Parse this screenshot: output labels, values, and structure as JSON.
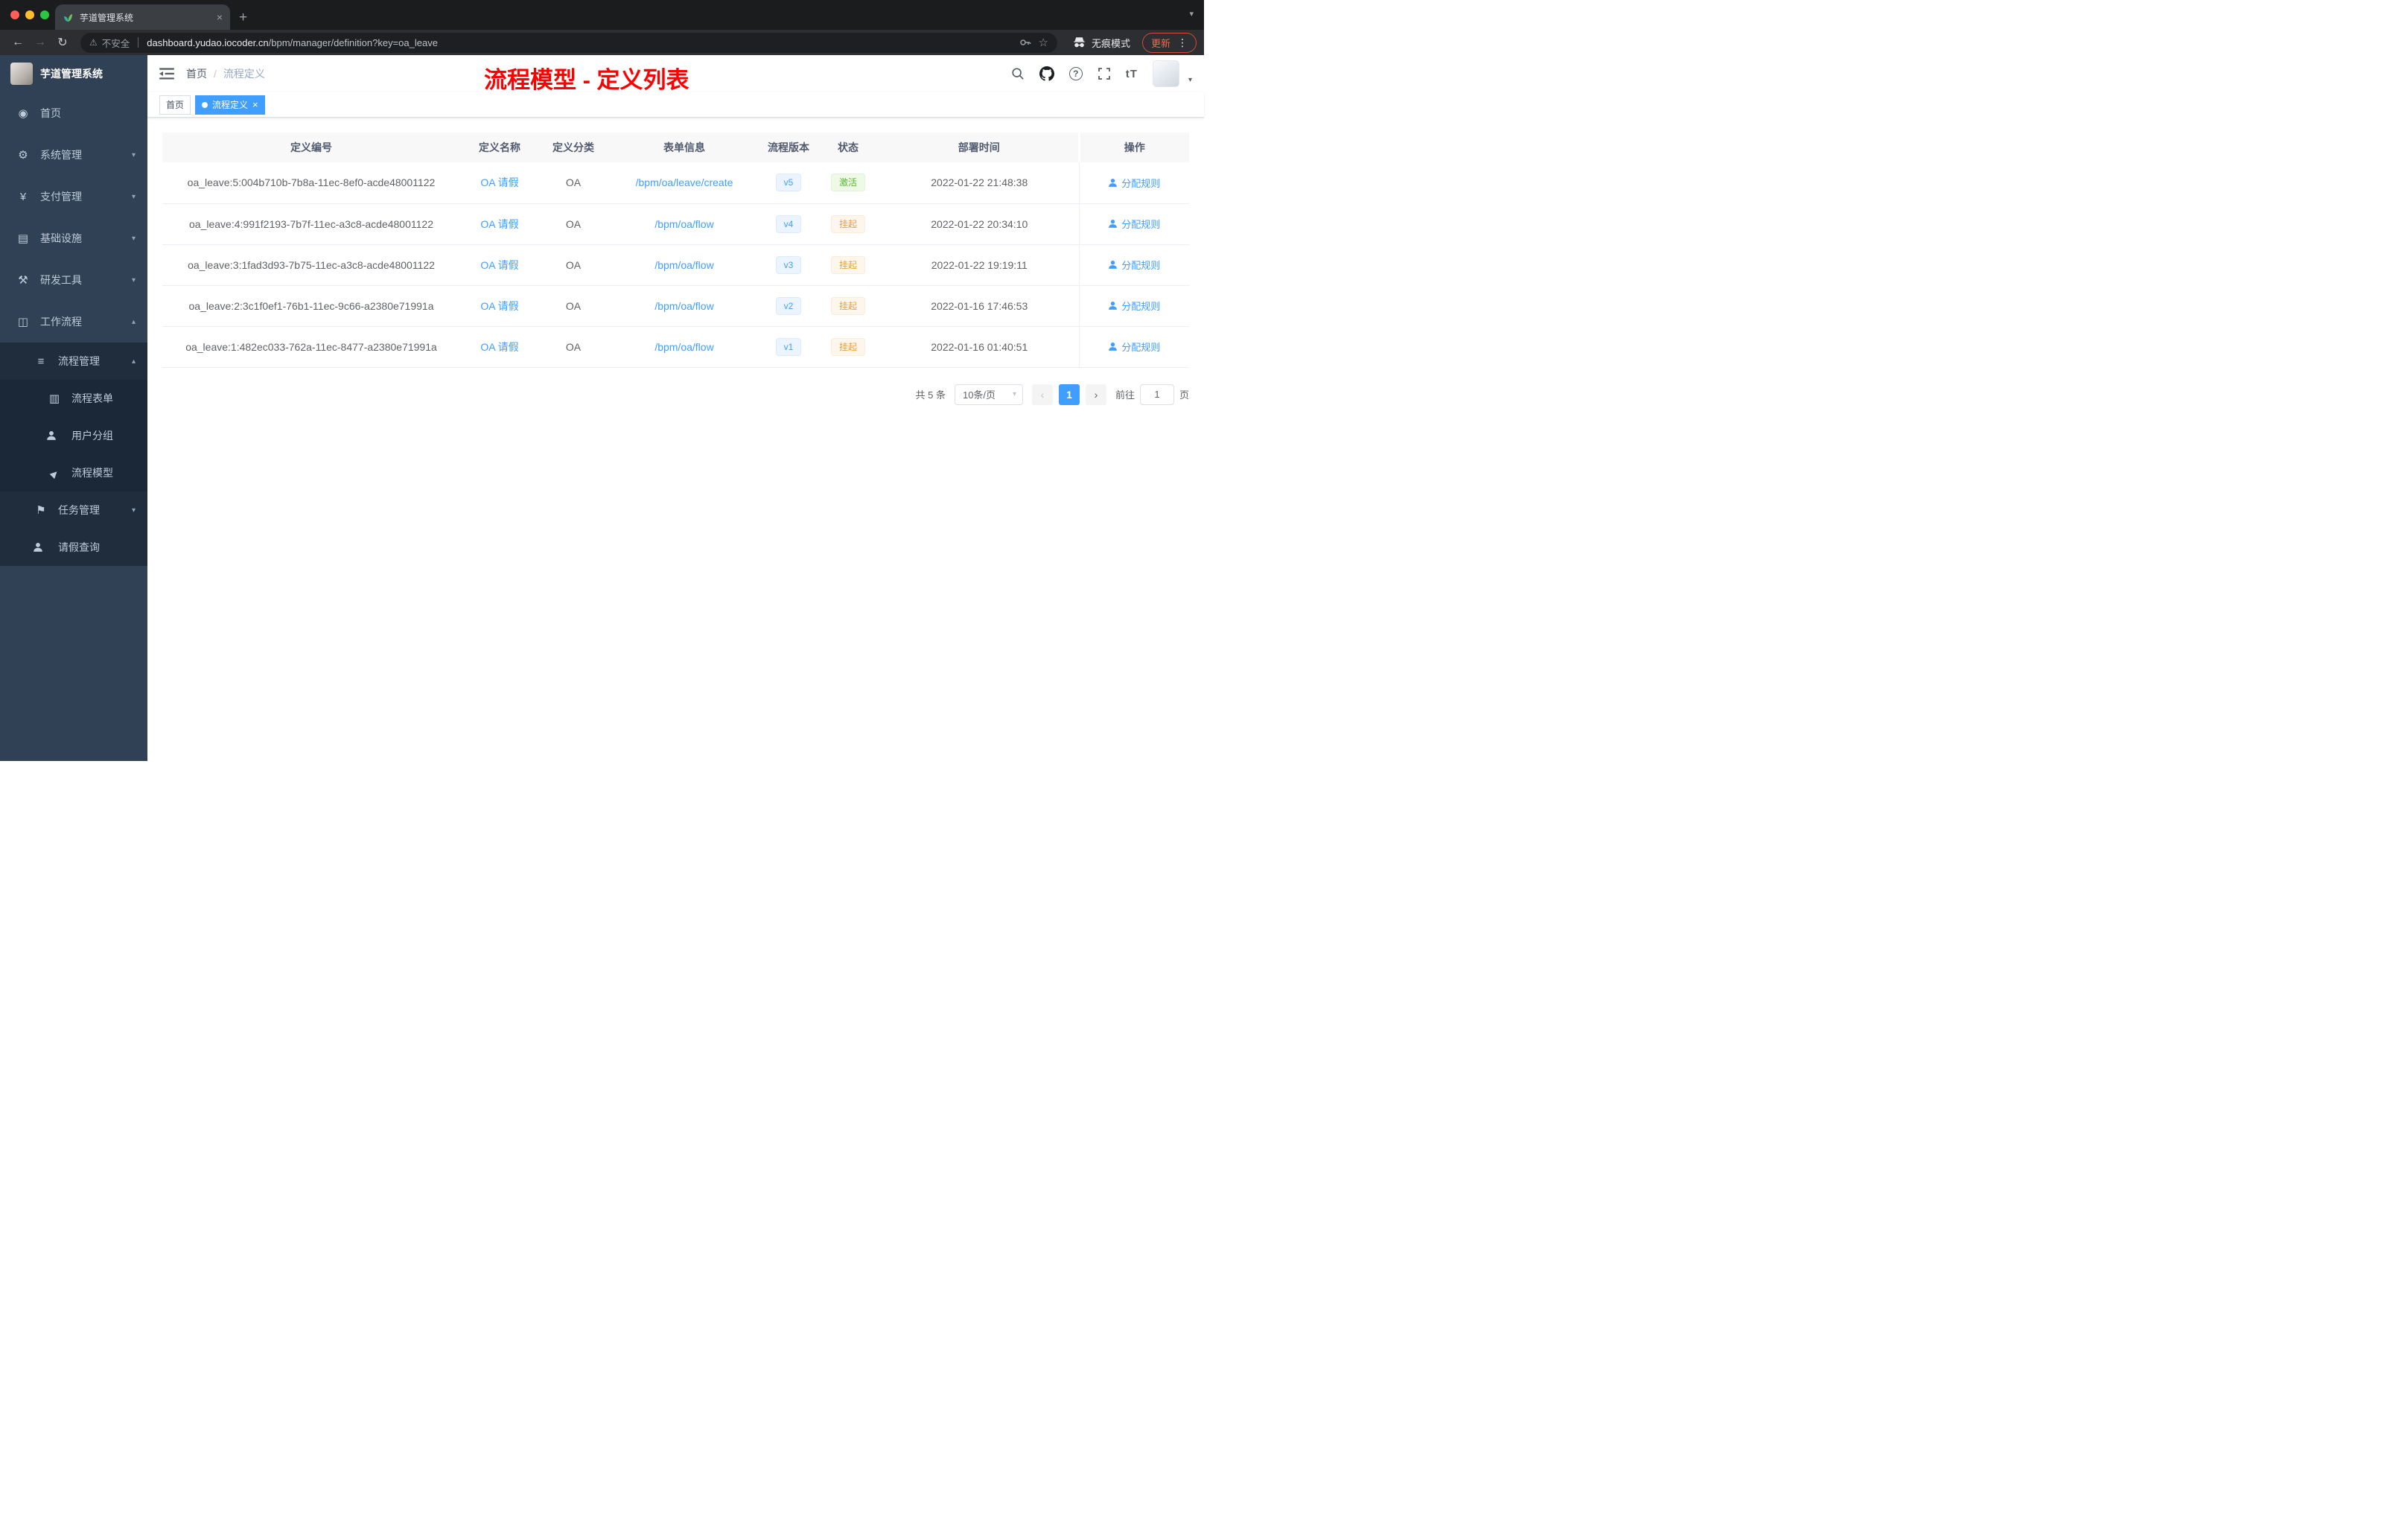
{
  "colors": {
    "accent": "#409eff",
    "success": "#67c23a",
    "warning": "#e6a23c",
    "annotation_red": "#ff0000",
    "sidebar_bg": "#304156",
    "submenu_bg": "#1f2d3d"
  },
  "browser": {
    "tab_title": "芋道管理系统",
    "new_tab_label": "+",
    "security_label": "不安全",
    "url_domain": "dashboard.yudao.iocoder.cn",
    "url_path": "/bpm/manager/definition?key=oa_leave",
    "incognito_label": "无痕模式",
    "update_label": "更新"
  },
  "sidebar": {
    "app_title": "芋道管理系统",
    "home": "首页",
    "system": "系统管理",
    "payment": "支付管理",
    "infrastructure": "基础设施",
    "devtools": "研发工具",
    "workflow": "工作流程",
    "process_mgmt": "流程管理",
    "process_form": "流程表单",
    "user_group": "用户分组",
    "process_model": "流程模型",
    "task_mgmt": "任务管理",
    "leave_query": "请假查询"
  },
  "header": {
    "breadcrumb_home": "首页",
    "breadcrumb_sep": "/",
    "breadcrumb_current": "流程定义",
    "annotation": "流程模型 - 定义列表"
  },
  "tags": {
    "home": "首页",
    "active": "流程定义",
    "close": "×"
  },
  "table": {
    "columns": [
      "定义编号",
      "定义名称",
      "定义分类",
      "表单信息",
      "流程版本",
      "状态",
      "部署时间",
      "操作"
    ],
    "rows": [
      {
        "id": "oa_leave:5:004b710b-7b8a-11ec-8ef0-acde48001122",
        "name": "OA 请假",
        "category": "OA",
        "form": "/bpm/oa/leave/create",
        "version": "v5",
        "status": {
          "label": "激活",
          "type": "success"
        },
        "deploy_time": "2022-01-22 21:48:38",
        "action": "分配规则"
      },
      {
        "id": "oa_leave:4:991f2193-7b7f-11ec-a3c8-acde48001122",
        "name": "OA 请假",
        "category": "OA",
        "form": "/bpm/oa/flow",
        "version": "v4",
        "status": {
          "label": "挂起",
          "type": "warning"
        },
        "deploy_time": "2022-01-22 20:34:10",
        "action": "分配规则"
      },
      {
        "id": "oa_leave:3:1fad3d93-7b75-11ec-a3c8-acde48001122",
        "name": "OA 请假",
        "category": "OA",
        "form": "/bpm/oa/flow",
        "version": "v3",
        "status": {
          "label": "挂起",
          "type": "warning"
        },
        "deploy_time": "2022-01-22 19:19:11",
        "action": "分配规则"
      },
      {
        "id": "oa_leave:2:3c1f0ef1-76b1-11ec-9c66-a2380e71991a",
        "name": "OA 请假",
        "category": "OA",
        "form": "/bpm/oa/flow",
        "version": "v2",
        "status": {
          "label": "挂起",
          "type": "warning"
        },
        "deploy_time": "2022-01-16 17:46:53",
        "action": "分配规则"
      },
      {
        "id": "oa_leave:1:482ec033-762a-11ec-8477-a2380e71991a",
        "name": "OA 请假",
        "category": "OA",
        "form": "/bpm/oa/flow",
        "version": "v1",
        "status": {
          "label": "挂起",
          "type": "warning"
        },
        "deploy_time": "2022-01-16 01:40:51",
        "action": "分配规则"
      }
    ]
  },
  "pagination": {
    "total": "共 5 条",
    "page_size": "10条/页",
    "current_page": "1",
    "goto_label": "前往",
    "goto_value": "1",
    "page_unit": "页"
  }
}
